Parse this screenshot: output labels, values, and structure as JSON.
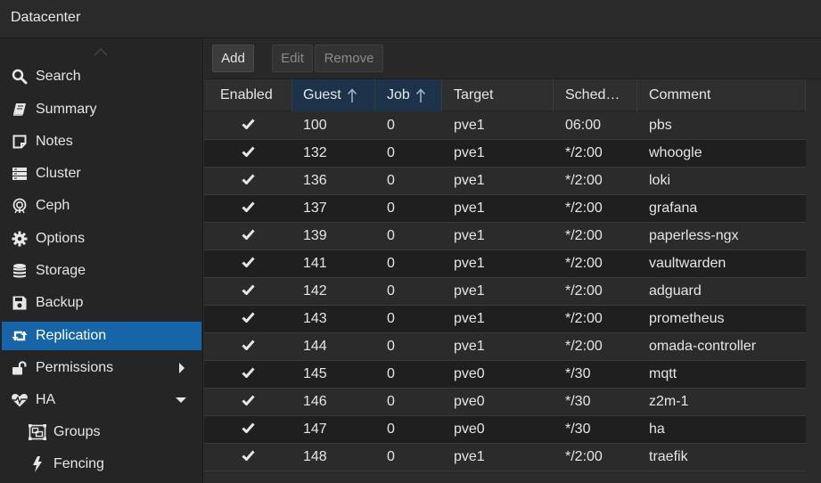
{
  "app": {
    "title": "Datacenter"
  },
  "sidebar": {
    "items": [
      {
        "label": "Search",
        "icon": "search-icon"
      },
      {
        "label": "Summary",
        "icon": "book-icon"
      },
      {
        "label": "Notes",
        "icon": "note-icon"
      },
      {
        "label": "Cluster",
        "icon": "server-icon"
      },
      {
        "label": "Ceph",
        "icon": "ceph-icon"
      },
      {
        "label": "Options",
        "icon": "gear-icon"
      },
      {
        "label": "Storage",
        "icon": "database-icon"
      },
      {
        "label": "Backup",
        "icon": "floppy-icon"
      },
      {
        "label": "Replication",
        "icon": "retweet-icon",
        "active": true
      },
      {
        "label": "Permissions",
        "icon": "unlock-icon"
      },
      {
        "label": "HA",
        "icon": "heartbeat-icon"
      },
      {
        "label": "Groups",
        "icon": "object-group-icon"
      },
      {
        "label": "Fencing",
        "icon": "bolt-icon"
      }
    ],
    "active_color": "#1565a8"
  },
  "toolbar": {
    "add_label": "Add",
    "edit_label": "Edit",
    "remove_label": "Remove"
  },
  "grid": {
    "columns": [
      {
        "label": "Enabled"
      },
      {
        "label": "Guest",
        "sorted": "asc"
      },
      {
        "label": "Job",
        "sorted": "asc"
      },
      {
        "label": "Target"
      },
      {
        "label": "Sched…"
      },
      {
        "label": "Comment"
      }
    ],
    "rows": [
      {
        "enabled": true,
        "guest": "100",
        "job": "0",
        "target": "pve1",
        "schedule": "06:00",
        "comment": "pbs"
      },
      {
        "enabled": true,
        "guest": "132",
        "job": "0",
        "target": "pve1",
        "schedule": "*/2:00",
        "comment": "whoogle"
      },
      {
        "enabled": true,
        "guest": "136",
        "job": "0",
        "target": "pve1",
        "schedule": "*/2:00",
        "comment": "loki"
      },
      {
        "enabled": true,
        "guest": "137",
        "job": "0",
        "target": "pve1",
        "schedule": "*/2:00",
        "comment": "grafana"
      },
      {
        "enabled": true,
        "guest": "139",
        "job": "0",
        "target": "pve1",
        "schedule": "*/2:00",
        "comment": "paperless-ngx"
      },
      {
        "enabled": true,
        "guest": "141",
        "job": "0",
        "target": "pve1",
        "schedule": "*/2:00",
        "comment": "vaultwarden"
      },
      {
        "enabled": true,
        "guest": "142",
        "job": "0",
        "target": "pve1",
        "schedule": "*/2:00",
        "comment": "adguard"
      },
      {
        "enabled": true,
        "guest": "143",
        "job": "0",
        "target": "pve1",
        "schedule": "*/2:00",
        "comment": "prometheus"
      },
      {
        "enabled": true,
        "guest": "144",
        "job": "0",
        "target": "pve1",
        "schedule": "*/2:00",
        "comment": "omada-controller"
      },
      {
        "enabled": true,
        "guest": "145",
        "job": "0",
        "target": "pve0",
        "schedule": "*/30",
        "comment": "mqtt"
      },
      {
        "enabled": true,
        "guest": "146",
        "job": "0",
        "target": "pve0",
        "schedule": "*/30",
        "comment": "z2m-1"
      },
      {
        "enabled": true,
        "guest": "147",
        "job": "0",
        "target": "pve0",
        "schedule": "*/30",
        "comment": "ha"
      },
      {
        "enabled": true,
        "guest": "148",
        "job": "0",
        "target": "pve1",
        "schedule": "*/2:00",
        "comment": "traefik"
      }
    ]
  }
}
